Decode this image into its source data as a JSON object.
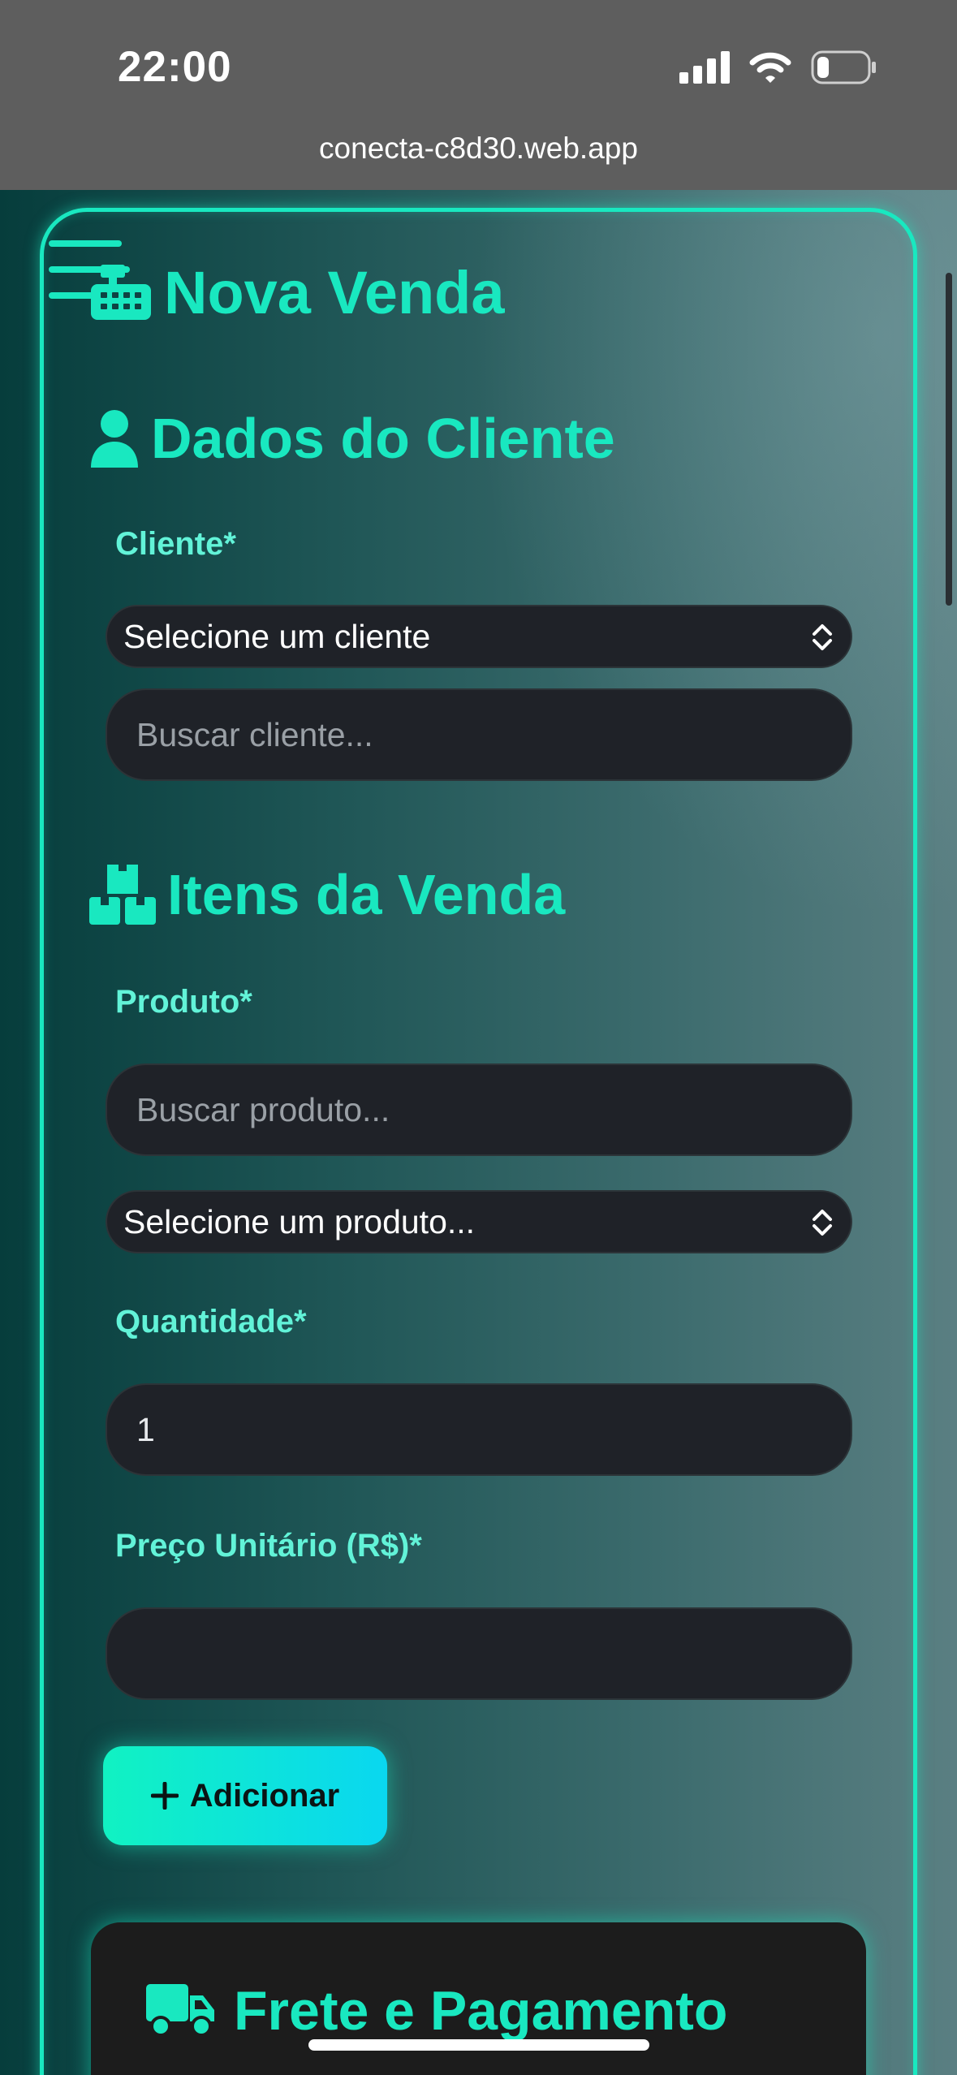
{
  "status_bar": {
    "time": "22:00",
    "url": "conecta-c8d30.web.app",
    "icons": [
      "signal-icon",
      "wifi-icon",
      "battery-icon"
    ]
  },
  "header": {
    "title": "Nova Venda",
    "menu_icon": "hamburger-menu-icon",
    "title_icon": "cash-register-icon"
  },
  "cliente_section": {
    "title": "Dados do Cliente",
    "icon": "user-icon",
    "cliente_label": "Cliente*",
    "cliente_select_value": "Selecione um cliente",
    "search_placeholder": "Buscar cliente..."
  },
  "itens_section": {
    "title": "Itens da Venda",
    "icon": "boxes-icon",
    "produto_label": "Produto*",
    "produto_search_placeholder": "Buscar produto...",
    "produto_select_value": "Selecione um produto...",
    "quantidade_label": "Quantidade*",
    "quantidade_value": "1",
    "preco_label": "Preço Unitário (R$)*",
    "preco_value": "",
    "add_button_label": "Adicionar"
  },
  "frete_section": {
    "title": "Frete e Pagamento",
    "icon": "truck-icon"
  },
  "colors": {
    "accent": "#19e8c0",
    "label": "#62f3d8",
    "field_bg": "#1f2228",
    "button_gradient_start": "#11f2c2",
    "button_gradient_end": "#0ad7f0"
  }
}
